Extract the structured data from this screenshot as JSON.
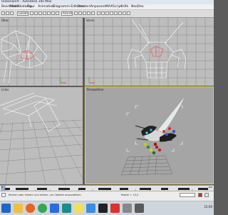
{
  "window": {
    "title": "Unbenannt - Autodesk 3ds Max"
  },
  "menu": [
    "Bearbeiten",
    "Modifikatoren",
    "Figur",
    "Animation",
    "Diagramm-Editoren",
    "Rendern",
    "Anpassen",
    "MAXScript",
    "Hilfe",
    "NeoDex"
  ],
  "toolbar": {
    "selection_filter": "Gesamt",
    "coordinate_system": "Ansicht"
  },
  "viewports": {
    "top_left": "Oben",
    "top_right": "Vorne",
    "bottom_left": "Links",
    "bottom_right": "Perspektive"
  },
  "colors": {
    "active_viewport_border": "#e6d43a",
    "wireframe": "#ffffff",
    "selection": "#ff3a3a",
    "grid": "#777777",
    "taskbar": "#cfd5dd"
  },
  "timeline": {
    "frame_start": "0",
    "frame_end": "100"
  },
  "status": {
    "hint": "Klicken oder klicken und ziehen, um Objekte auszuwählen",
    "coord_label": "Raster = 10,0"
  },
  "taskbar": {
    "apps": [
      "windows-start-icon",
      "file-explorer-icon",
      "firefox-icon",
      "chrome-icon",
      "media-icon",
      "3dsmax-icon",
      "app-icon",
      "app-icon",
      "app-icon",
      "app-icon",
      "app-icon",
      "app-icon"
    ],
    "clock": "12:00"
  }
}
